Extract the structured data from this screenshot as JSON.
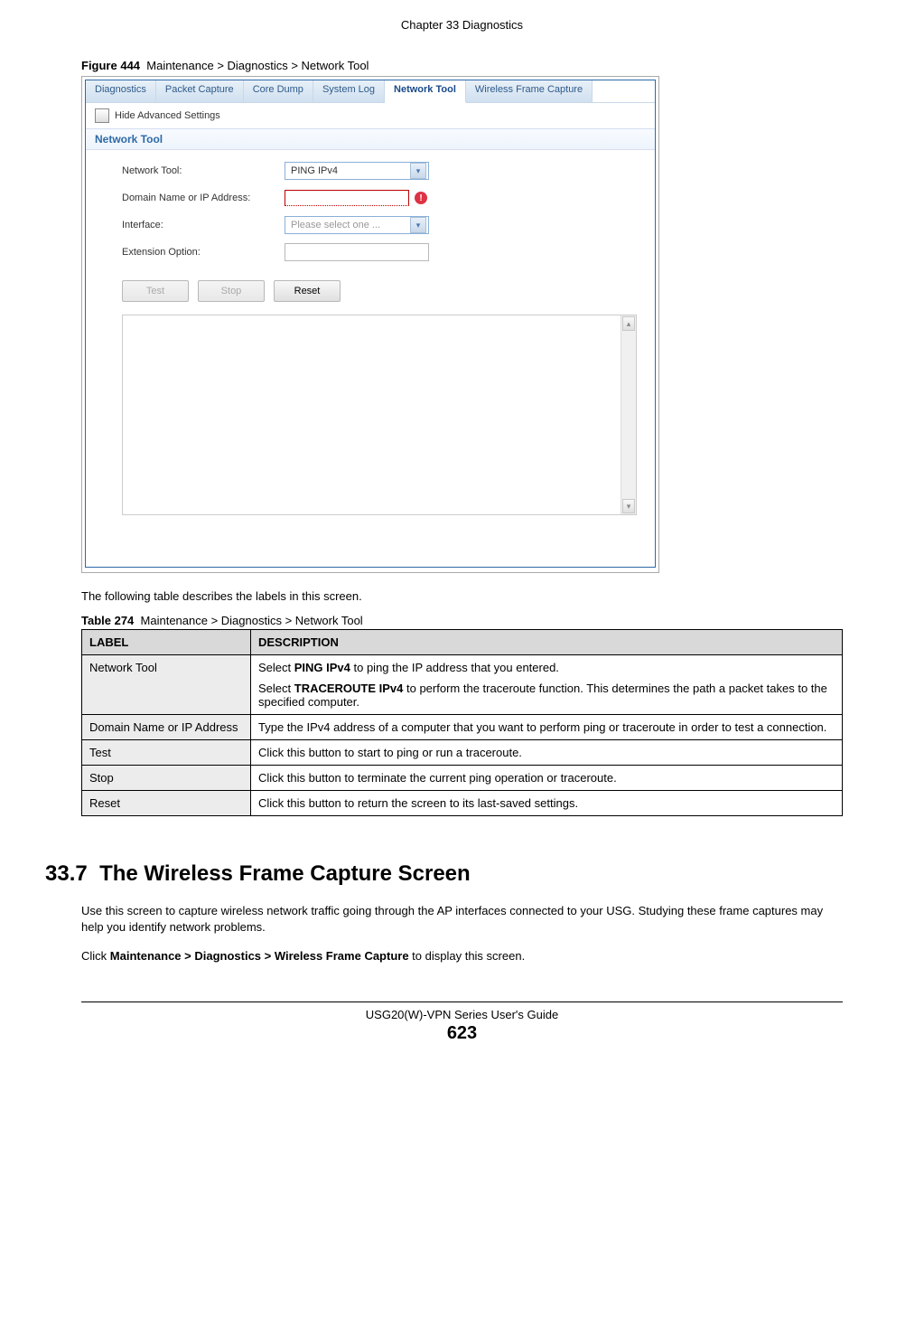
{
  "header": {
    "chapter": "Chapter 33 Diagnostics"
  },
  "figure": {
    "label": "Figure 444",
    "caption": "Maintenance > Diagnostics > Network Tool"
  },
  "screenshot": {
    "tabs": [
      "Diagnostics",
      "Packet Capture",
      "Core Dump",
      "System Log",
      "Network Tool",
      "Wireless Frame Capture"
    ],
    "active_tab_index": 4,
    "advanced_toggle": "Hide Advanced Settings",
    "section_title": "Network Tool",
    "fields": {
      "network_tool_label": "Network Tool:",
      "network_tool_value": "PING IPv4",
      "domain_label": "Domain Name or IP Address:",
      "domain_value": "",
      "interface_label": "Interface:",
      "interface_placeholder": "Please select one ...",
      "ext_label": "Extension Option:",
      "ext_value": ""
    },
    "buttons": {
      "test": "Test",
      "stop": "Stop",
      "reset": "Reset"
    }
  },
  "intro": "The following table describes the labels in this screen.",
  "table": {
    "label": "Table 274",
    "caption": "Maintenance > Diagnostics > Network Tool",
    "header": {
      "col1": "LABEL",
      "col2": "DESCRIPTION"
    },
    "rows": [
      {
        "label": "Network Tool",
        "desc_parts": [
          {
            "pre": "Select ",
            "bold": "PING IPv4",
            "post": " to ping the IP address that you entered."
          },
          {
            "pre": "Select ",
            "bold": "TRACEROUTE IPv4",
            "post": " to perform the traceroute function. This determines the path a packet takes to the specified computer."
          }
        ]
      },
      {
        "label": "Domain Name or IP Address",
        "desc_plain": "Type the IPv4 address of a computer that you want to perform ping or traceroute in order to test a connection."
      },
      {
        "label": "Test",
        "desc_plain": "Click this button to start to ping or run a traceroute."
      },
      {
        "label": "Stop",
        "desc_plain": "Click this button to terminate the current ping operation or traceroute."
      },
      {
        "label": "Reset",
        "desc_plain": "Click this button to return the screen to its last-saved settings."
      }
    ]
  },
  "section": {
    "number": "33.7",
    "title": "The Wireless Frame Capture Screen",
    "para1": "Use this screen to capture wireless network traffic going through the AP interfaces connected to your USG. Studying these frame captures may help you identify network problems.",
    "para2_pre": "Click ",
    "para2_bold": "Maintenance > Diagnostics > Wireless Frame Capture",
    "para2_post": " to display this screen."
  },
  "footer": {
    "guide": "USG20(W)-VPN Series User's Guide",
    "page": "623"
  }
}
